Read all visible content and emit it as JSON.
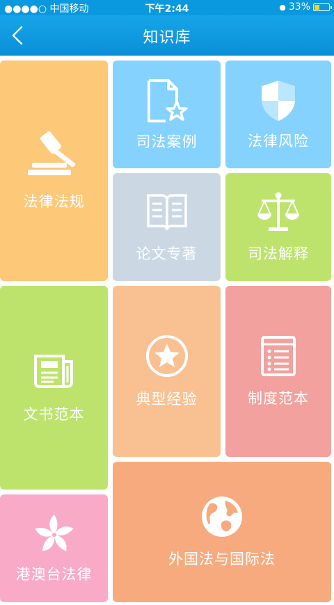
{
  "status": {
    "carrier": "●●●●○ 中国移动",
    "time": "下午2:44",
    "battery": "33%",
    "battery_level": 0.33
  },
  "nav": {
    "title": "知识库",
    "back_icon": "chevron-left-icon"
  },
  "tiles": {
    "laws": {
      "label": "法律法规",
      "icon": "gavel-icon",
      "color": "#fdc877"
    },
    "cases": {
      "label": "司法案例",
      "icon": "document-star-icon",
      "color": "#84d2fd"
    },
    "risks": {
      "label": "法律风险",
      "icon": "shield-icon",
      "color": "#84d2fd"
    },
    "papers": {
      "label": "论文专著",
      "icon": "open-book-icon",
      "color": "#cbd8e4"
    },
    "interpret": {
      "label": "司法解释",
      "icon": "scales-icon",
      "color": "#bde36d"
    },
    "templates": {
      "label": "文书范本",
      "icon": "newspaper-icon",
      "color": "#bde36d"
    },
    "experience": {
      "label": "典型经验",
      "icon": "star-circle-icon",
      "color": "#f9c192"
    },
    "systems": {
      "label": "制度范本",
      "icon": "list-document-icon",
      "color": "#f2a19e"
    },
    "hkmt": {
      "label": "港澳台法律",
      "icon": "bauhinia-icon",
      "color": "#f8aac7"
    },
    "foreign": {
      "label": "外国法与国际法",
      "icon": "globe-icon",
      "color": "#f6aa7e"
    }
  }
}
